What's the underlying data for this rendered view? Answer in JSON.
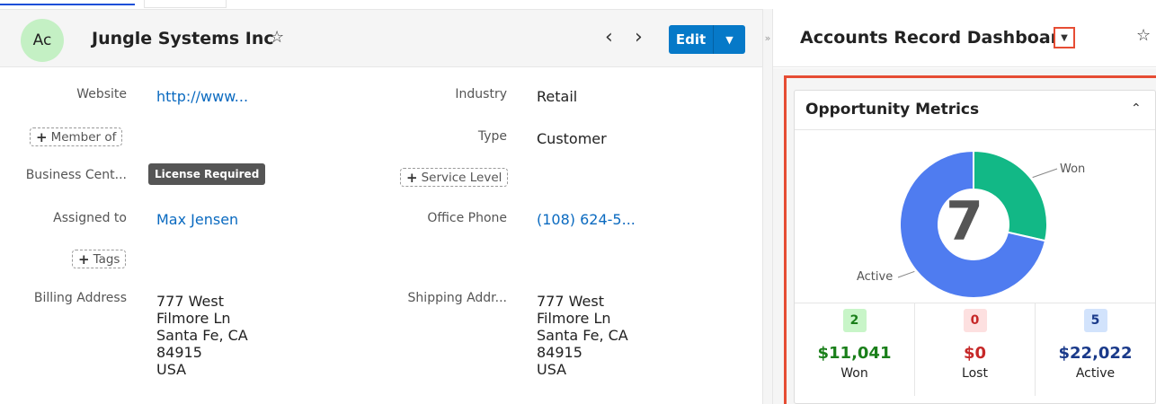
{
  "record": {
    "avatar": "Ac",
    "title": "Jungle Systems Inc",
    "favorite_icon": "star-outline-icon",
    "edit_label": "Edit"
  },
  "fields": {
    "website": {
      "label": "Website",
      "value": "http://www..."
    },
    "industry": {
      "label": "Industry",
      "value": "Retail"
    },
    "member_of": {
      "label": "Member of"
    },
    "type": {
      "label": "Type",
      "value": "Customer"
    },
    "business_center": {
      "label": "Business Cent...",
      "badge": "License Required"
    },
    "service_level": {
      "label": "Service Level"
    },
    "assigned_to": {
      "label": "Assigned to",
      "value": "Max Jensen"
    },
    "office_phone": {
      "label": "Office Phone",
      "value": "(108) 624-5..."
    },
    "tags": {
      "label": "Tags"
    },
    "billing_address": {
      "label": "Billing Address",
      "lines": [
        "777 West",
        "Filmore Ln",
        "Santa Fe, CA",
        "84915",
        "USA"
      ]
    },
    "shipping_address": {
      "label": "Shipping Addr...",
      "lines": [
        "777 West",
        "Filmore Ln",
        "Santa Fe, CA",
        "84915",
        "USA"
      ]
    }
  },
  "dashboard": {
    "title": "Accounts Record Dashboard",
    "dashlet": {
      "title": "Opportunity Metrics",
      "total": "7",
      "won_label": "Won",
      "active_label": "Active"
    }
  },
  "chart_data": {
    "type": "pie",
    "categories": [
      "Won",
      "Lost",
      "Active"
    ],
    "values": [
      2,
      0,
      5
    ],
    "colors": [
      "#12b886",
      "#e53935",
      "#4f7cf0"
    ],
    "center_label": "7"
  },
  "metrics": [
    {
      "count": "2",
      "amount": "$11,041",
      "label": "Won",
      "badge_bg": "#c8f5c8",
      "badge_fg": "#1a7f1a",
      "amount_color": "#1a7f1a"
    },
    {
      "count": "0",
      "amount": "$0",
      "label": "Lost",
      "badge_bg": "#fde0e0",
      "badge_fg": "#c62828",
      "amount_color": "#c62828"
    },
    {
      "count": "5",
      "amount": "$22,022",
      "label": "Active",
      "badge_bg": "#d2e3fc",
      "badge_fg": "#1a3a8a",
      "amount_color": "#1a3a8a"
    }
  ]
}
